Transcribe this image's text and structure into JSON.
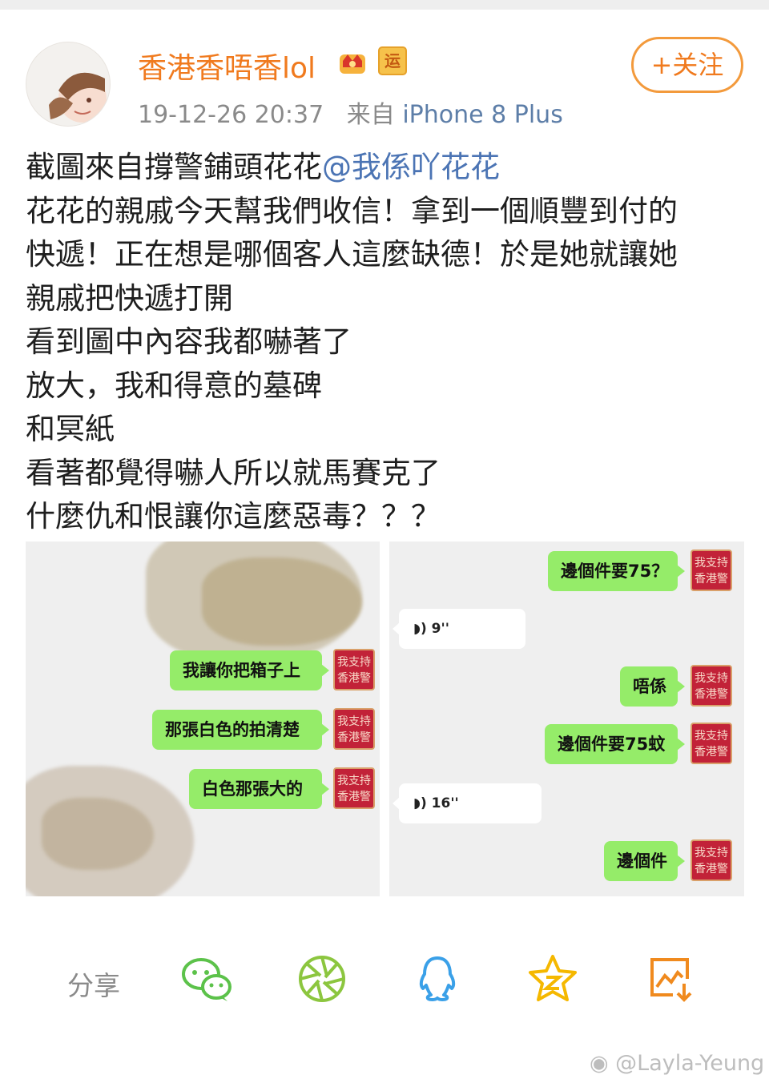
{
  "header": {
    "username": "香港香唔香lol",
    "timestamp": "19-12-26 20:37",
    "source_prefix": "来自",
    "source_device": "iPhone 8 Plus",
    "follow_label": "+关注",
    "badge_yun": "运"
  },
  "post": {
    "line1_text": "截圖來自撐警鋪頭花花",
    "line1_mention": "@我係吖花花",
    "line2": "花花的親戚今天幫我們收信！拿到一個順豐到付的",
    "line3": "快遞！正在想是哪個客人這麼缺德！於是她就讓她",
    "line4": "親戚把快遞打開",
    "line5": "看到圖中內容我都嚇著了",
    "line6": "放大，我和得意的墓碑",
    "line7": "和冥紙",
    "line8": "看著都覺得嚇人所以就馬賽克了",
    "line9": "什麼仇和恨讓你這麼惡毒？？？"
  },
  "image1": {
    "messages": [
      "我讓你把箱子上",
      "那張白色的拍清楚",
      "白色那張大的"
    ],
    "avatar_line1": "我支持",
    "avatar_line2": "香港警"
  },
  "image2": {
    "msg1": "邊個件要75？",
    "voice1": "9''",
    "msg2": "唔係",
    "msg3": "邊個件要75蚊",
    "voice2": "16''",
    "msg4": "邊個件",
    "avatar_line1": "我支持",
    "avatar_line2": "香港警"
  },
  "share": {
    "label": "分享",
    "icons": [
      "wechat-icon",
      "moments-icon",
      "qq-icon",
      "qzone-icon",
      "save-image-icon"
    ]
  },
  "watermark": "@Layla-Yeung",
  "colors": {
    "username": "#f07a1e",
    "mention": "#4b74b4",
    "bubble": "#95ec69",
    "share_green": "#5cc24a",
    "share_blue": "#3aa0e8",
    "share_yellow": "#f5b800",
    "share_orange": "#f08a1e"
  }
}
